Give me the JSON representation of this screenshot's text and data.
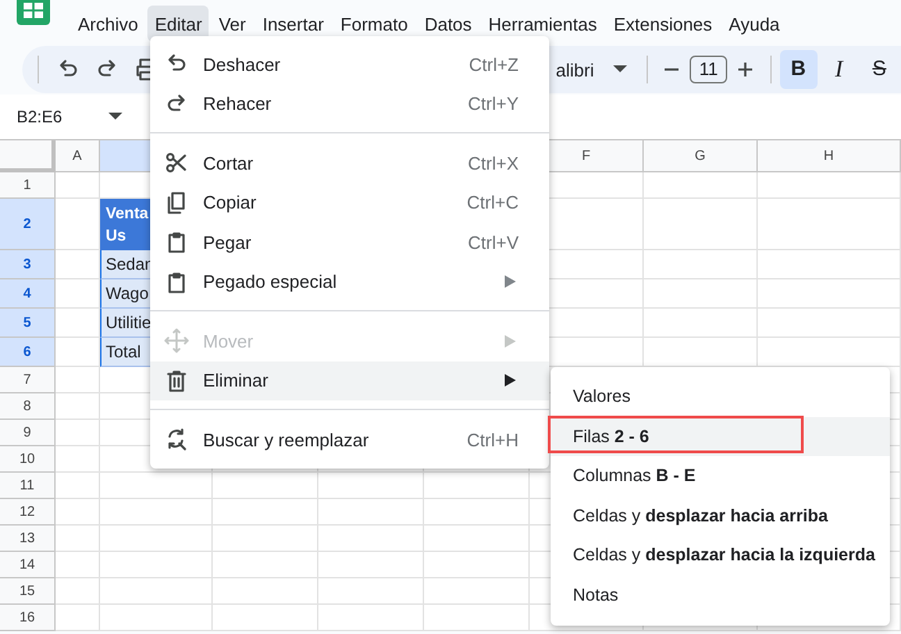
{
  "menu_bar": {
    "items": [
      {
        "label": "Archivo",
        "selected": false
      },
      {
        "label": "Editar",
        "selected": true
      },
      {
        "label": "Ver",
        "selected": false
      },
      {
        "label": "Insertar",
        "selected": false
      },
      {
        "label": "Formato",
        "selected": false
      },
      {
        "label": "Datos",
        "selected": false
      },
      {
        "label": "Herramientas",
        "selected": false
      },
      {
        "label": "Extensiones",
        "selected": false
      },
      {
        "label": "Ayuda",
        "selected": false
      }
    ]
  },
  "toolbar": {
    "font": "alibri",
    "font_size": "11",
    "format_buttons": [
      {
        "label": "B",
        "kind": "bold",
        "selected": true
      },
      {
        "label": "I",
        "kind": "italic",
        "selected": false
      },
      {
        "label": "S",
        "kind": "strike",
        "selected": false
      }
    ]
  },
  "name_box": "B2:E6",
  "sheet": {
    "columns": [
      {
        "kind": "header",
        "label": "A",
        "selected": false
      },
      {
        "kind": "header",
        "selected": true
      },
      {
        "kind": "covered"
      },
      {
        "kind": "covered"
      },
      {
        "kind": "covered"
      },
      {
        "kind": "header",
        "label": "F",
        "selected": false
      },
      {
        "kind": "header",
        "label": "G",
        "selected": false
      },
      {
        "kind": "header",
        "label": "H",
        "selected": false
      }
    ],
    "rows": [
      {
        "label": "1",
        "selected": false
      },
      {
        "label": "2",
        "selected": true,
        "cell": {
          "kind": "header",
          "lines": [
            "Venta",
            "Us"
          ]
        }
      },
      {
        "label": "3",
        "selected": true,
        "cell": {
          "kind": "data",
          "lines": [
            "Sedan"
          ]
        }
      },
      {
        "label": "4",
        "selected": true,
        "cell": {
          "kind": "data",
          "lines": [
            "Wago"
          ]
        }
      },
      {
        "label": "5",
        "selected": true,
        "cell": {
          "kind": "data",
          "lines": [
            "Utilitie"
          ]
        }
      },
      {
        "label": "6",
        "selected": true,
        "cell": {
          "kind": "data",
          "lines": [
            "Total"
          ]
        }
      },
      {
        "label": "7",
        "selected": false
      },
      {
        "label": "8",
        "selected": false
      },
      {
        "label": "9",
        "selected": false
      },
      {
        "label": "10",
        "selected": false
      },
      {
        "label": "11",
        "selected": false
      },
      {
        "label": "12",
        "selected": false
      },
      {
        "label": "13",
        "selected": false
      },
      {
        "label": "14",
        "selected": false
      },
      {
        "label": "15",
        "selected": false
      },
      {
        "label": "16",
        "selected": false
      }
    ]
  },
  "edit_menu": {
    "items": [
      {
        "kind": "item",
        "label": "Deshacer",
        "shortcut": "Ctrl+Z",
        "disabled": false,
        "selected": false
      },
      {
        "kind": "item",
        "label": "Rehacer",
        "shortcut": "Ctrl+Y",
        "disabled": false,
        "selected": false
      },
      {
        "kind": "divider"
      },
      {
        "kind": "item",
        "label": "Cortar",
        "shortcut": "Ctrl+X",
        "disabled": false,
        "selected": false
      },
      {
        "kind": "item",
        "label": "Copiar",
        "shortcut": "Ctrl+C",
        "disabled": false,
        "selected": false
      },
      {
        "kind": "item",
        "label": "Pegar",
        "shortcut": "Ctrl+V",
        "disabled": false,
        "selected": false
      },
      {
        "kind": "item",
        "label": "Pegado especial",
        "disabled": false,
        "selected": false,
        "submenu": true
      },
      {
        "kind": "divider"
      },
      {
        "kind": "item",
        "label": "Mover",
        "disabled": true,
        "selected": false,
        "submenu": true
      },
      {
        "kind": "item",
        "label": "Eliminar",
        "disabled": false,
        "selected": true,
        "submenu": true
      },
      {
        "kind": "divider"
      },
      {
        "kind": "item",
        "label": "Buscar y reemplazar",
        "shortcut": "Ctrl+H",
        "disabled": false,
        "selected": false
      }
    ]
  },
  "delete_submenu": {
    "items": [
      {
        "label": "Valores",
        "selected": false,
        "annotated": false
      },
      {
        "label": "Filas **2 - 6**",
        "selected": true,
        "annotated": true
      },
      {
        "label": "Columnas **B - E**",
        "selected": false,
        "annotated": false
      },
      {
        "label": "Celdas y **desplazar hacia arriba**",
        "selected": false,
        "annotated": false
      },
      {
        "label": "Celdas y **desplazar hacia la izquierda**",
        "selected": false,
        "annotated": false
      },
      {
        "label": "Notas",
        "selected": false,
        "annotated": false
      }
    ]
  }
}
